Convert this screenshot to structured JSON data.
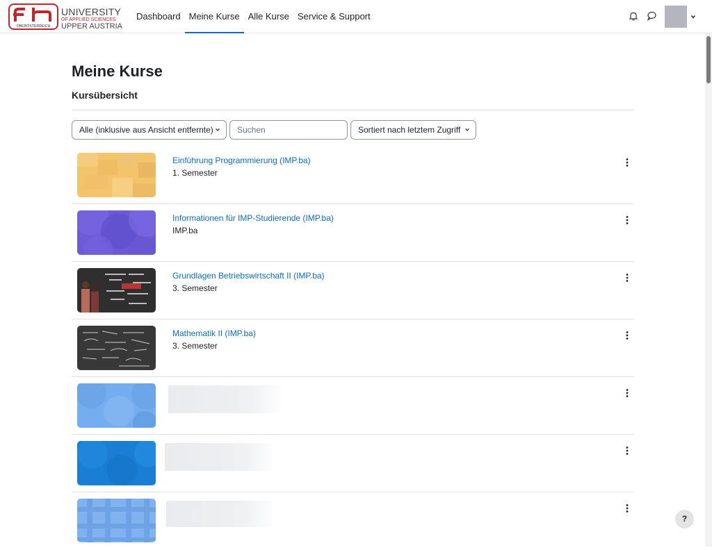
{
  "brand": {
    "logo_mark": "fh",
    "logo_sub": "OBERÖSTERREICH",
    "line1": "UNIVERSITY",
    "line2": "OF APPLIED SCIENCES",
    "line3": "UPPER AUSTRIA",
    "red": "#c0262d"
  },
  "nav": {
    "items": [
      {
        "label": "Dashboard"
      },
      {
        "label": "Meine Kurse",
        "active": true
      },
      {
        "label": "Alle Kurse"
      },
      {
        "label": "Service & Support"
      }
    ]
  },
  "header_icons": [
    "bell-icon",
    "chat-icon",
    "avatar",
    "chevron-down-icon"
  ],
  "page": {
    "title": "Meine Kurse",
    "subtitle": "Kursübersicht"
  },
  "filters": {
    "grouping": "Alle (inklusive aus Ansicht entfernte)",
    "search_placeholder": "Suchen",
    "sort": "Sortiert nach letztem Zugriff"
  },
  "courses": [
    {
      "name": "Einführung Programmierung (IMP.ba)",
      "category": "1. Semester"
    },
    {
      "name": "Informationen für IMP-Studierende (IMP.ba)",
      "category": "IMP.ba"
    },
    {
      "name": "Grundlagen Betriebswirtschaft II (IMP.ba)",
      "category": "3. Semester"
    },
    {
      "name": "Mathematik II (IMP.ba)",
      "category": "3. Semester"
    },
    {
      "name": "",
      "category": ""
    },
    {
      "name": "",
      "category": ""
    },
    {
      "name": "",
      "category": ""
    }
  ],
  "help": {
    "label": "?"
  },
  "colors": {
    "link": "#0f6cbf",
    "border": "#dee2e6"
  }
}
